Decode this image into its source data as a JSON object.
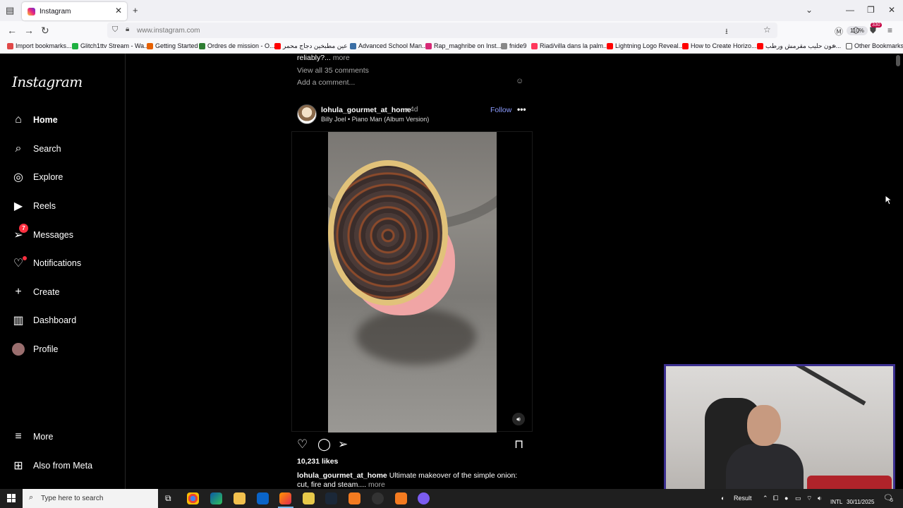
{
  "browser": {
    "tab_title": "Instagram",
    "url": "www.instagram.com",
    "zoom": "110%",
    "ext_badge": "330",
    "bookmarks": [
      {
        "label": "Import bookmarks...",
        "color": "#e04848"
      },
      {
        "label": "Glitch1ttv Stream - Wa...",
        "color": "#1fb141"
      },
      {
        "label": "Getting Started",
        "color": "#e66000"
      },
      {
        "label": "Ordres de mission - O...",
        "color": "#2e7d32"
      },
      {
        "label": "عين مطبخين دجاج محمر ...",
        "color": "#ff0000"
      },
      {
        "label": "Advanced School Man...",
        "color": "#3a6ea5"
      },
      {
        "label": "Rap_maghribe on Inst...",
        "color": "#d62976"
      },
      {
        "label": "fnide9",
        "color": "#888888"
      },
      {
        "label": "Riad/villa dans la palm...",
        "color": "#ff385c"
      },
      {
        "label": "Lightning Logo Reveal...",
        "color": "#ff0000"
      },
      {
        "label": "How to Create Horizo...",
        "color": "#ff0000"
      },
      {
        "label": "عون حليب مقرمش ورطب...",
        "color": "#ff0000"
      }
    ],
    "other_bookmarks": "Other Bookmarks"
  },
  "sidebar": {
    "logo": "Instagram",
    "items": [
      {
        "label": "Home",
        "icon": "home-icon"
      },
      {
        "label": "Search",
        "icon": "search-icon"
      },
      {
        "label": "Explore",
        "icon": "compass-icon"
      },
      {
        "label": "Reels",
        "icon": "reels-icon"
      },
      {
        "label": "Messages",
        "icon": "messenger-icon",
        "badge": "7"
      },
      {
        "label": "Notifications",
        "icon": "heart-icon"
      },
      {
        "label": "Create",
        "icon": "plus-icon"
      },
      {
        "label": "Dashboard",
        "icon": "dashboard-icon"
      },
      {
        "label": "Profile",
        "icon": "avatar"
      }
    ],
    "more": "More",
    "also_from_meta": "Also from Meta"
  },
  "prev_post": {
    "caption_tail": "reliably?...",
    "more": "more",
    "view_comments": "View all 35 comments",
    "add_comment_placeholder": "Add a comment..."
  },
  "post": {
    "username": "lohula_gourmet_at_home",
    "time": "• 4d",
    "audio": "Billy Joel • Piano Man (Album Version)",
    "follow": "Follow",
    "likes": "10,231 likes",
    "caption_user": "lohula_gourmet_at_home",
    "caption_text": "Ultimate makeover of the simple onion: cut, fire and steam....",
    "caption_more": "more"
  },
  "taskbar": {
    "search_placeholder": "Type here to search",
    "result": "Result",
    "lang": "INTL",
    "date": "30/11/2025",
    "notif_count": "5"
  }
}
